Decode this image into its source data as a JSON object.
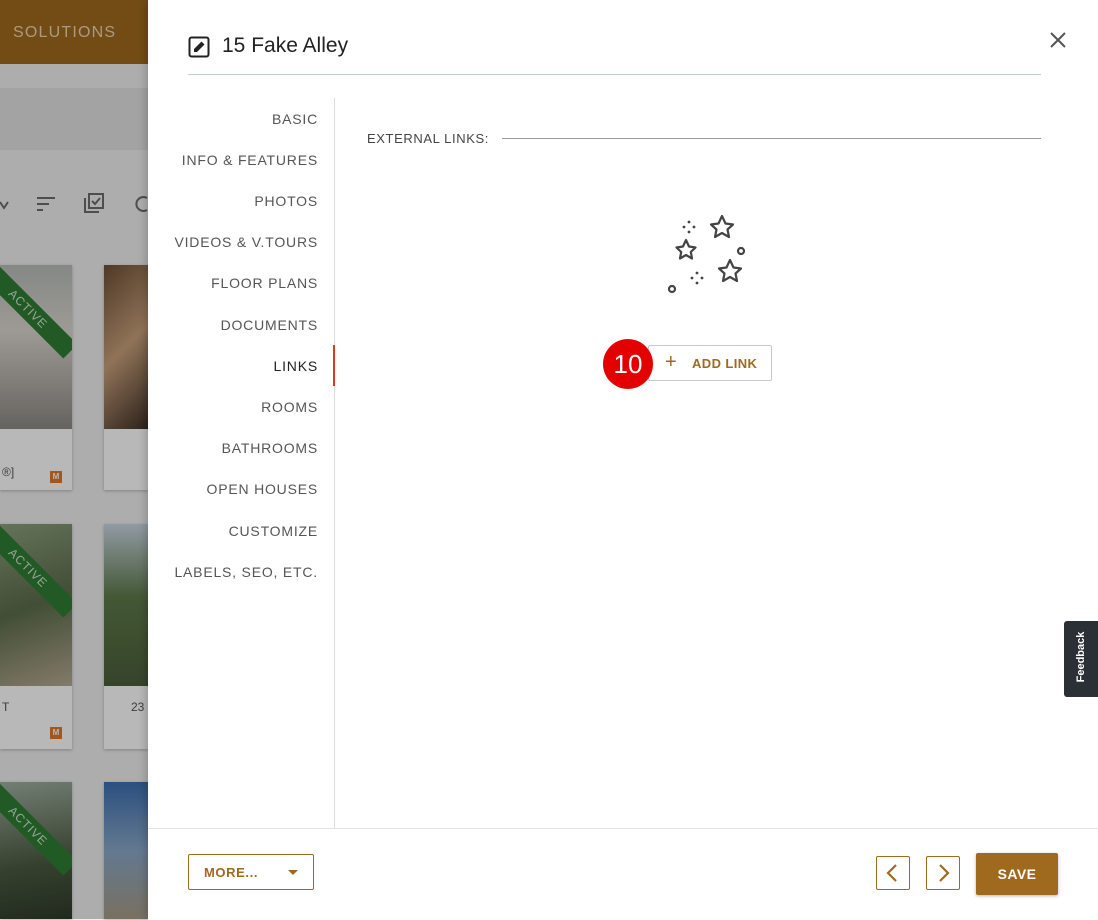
{
  "background": {
    "brand_fragment": "SOLUTIONS",
    "ribbon_label": "ACTIVE",
    "card_text_1": "®]",
    "card_text_2": "T",
    "card_text_3": "23",
    "badge_letter": "M"
  },
  "dialog": {
    "title": "15 Fake Alley",
    "nav_items": [
      {
        "label": "BASIC"
      },
      {
        "label": "INFO & FEATURES"
      },
      {
        "label": "PHOTOS"
      },
      {
        "label": "VIDEOS & V.TOURS"
      },
      {
        "label": "FLOOR PLANS"
      },
      {
        "label": "DOCUMENTS"
      },
      {
        "label": "LINKS"
      },
      {
        "label": "ROOMS"
      },
      {
        "label": "BATHROOMS"
      },
      {
        "label": "OPEN HOUSES"
      },
      {
        "label": "CUSTOMIZE"
      },
      {
        "label": "LABELS, SEO, ETC."
      }
    ],
    "active_nav": "LINKS",
    "section_label": "EXTERNAL LINKS:",
    "add_link_label": "ADD LINK",
    "step_badge": "10",
    "footer": {
      "more_label": "MORE...",
      "save_label": "SAVE"
    }
  },
  "feedback_label": "Feedback",
  "colors": {
    "accent": "#a06a1e",
    "active_indicator": "#d9391e",
    "badge": "#e30000",
    "ribbon": "#2e7d32"
  },
  "icons": [
    "edit-icon",
    "close-icon",
    "stars-icon",
    "plus-icon",
    "chevron-left-icon",
    "chevron-right-icon",
    "caret-down-icon",
    "sort-icon",
    "select-all-icon",
    "refresh-icon"
  ]
}
